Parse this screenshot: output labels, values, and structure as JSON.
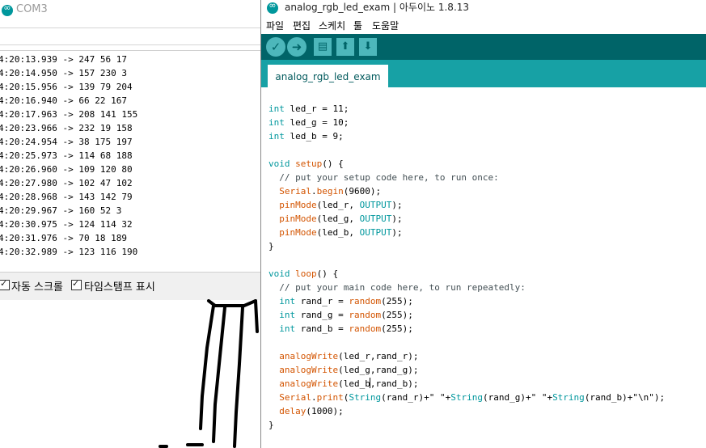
{
  "serial_monitor": {
    "title": "COM3",
    "lines": [
      "4:20:13.939 -> 247 56 17",
      "4:20:14.950 -> 157 230 3",
      "4:20:15.956 -> 139 79 204",
      "4:20:16.940 -> 66 22 167",
      "4:20:17.963 -> 208 141 155",
      "4:20:23.966 -> 232 19 158",
      "4:20:24.954 -> 38 175 197",
      "4:20:25.973 -> 114 68 188",
      "4:20:26.960 -> 109 120 80",
      "4:20:27.980 -> 102 47 102",
      "4:20:28.968 -> 143 142 79",
      "4:20:29.967 -> 160 52 3",
      "4:20:30.975 -> 124 114 32",
      "4:20:31.976 -> 70 18 189",
      "4:20:32.989 -> 123 116 190"
    ],
    "autoscroll_label": "자동 스크롤",
    "autoscroll_checked": true,
    "timestamp_label": "타임스탬프 표시",
    "timestamp_checked": true
  },
  "ide": {
    "title": "analog_rgb_led_exam | 아두이노 1.8.13",
    "menu": [
      "파일",
      "편집",
      "스케치",
      "툴",
      "도움말"
    ],
    "toolbar": {
      "verify_icon": "check-icon",
      "upload_icon": "arrow-right-icon",
      "new_icon": "file-icon",
      "open_icon": "arrow-up-icon",
      "save_icon": "arrow-down-icon"
    },
    "tab": "analog_rgb_led_exam",
    "code_lines": [
      "int led_r = 11;",
      "int led_g = 10;",
      "int led_b = 9;",
      "",
      "void setup() {",
      "  // put your setup code here, to run once:",
      "  Serial.begin(9600);",
      "  pinMode(led_r, OUTPUT);",
      "  pinMode(led_g, OUTPUT);",
      "  pinMode(led_b, OUTPUT);",
      "}",
      "",
      "void loop() {",
      "  // put your main code here, to run repeatedly:",
      "  int rand_r = random(255);",
      "  int rand_g = random(255);",
      "  int rand_b = random(255);",
      "",
      "  analogWrite(led_r,rand_r);",
      "  analogWrite(led_g,rand_g);",
      "  analogWrite(led_b,rand_b);",
      "  Serial.print(String(rand_r)+\" \"+String(rand_g)+\" \"+String(rand_b)+\"\\n\");",
      "  delay(1000);",
      "}"
    ]
  },
  "colors": {
    "toolbar_bg": "#006468",
    "tab_bar_bg": "#17a1a5",
    "button_bg": "#4db7bb",
    "keyword": "#00979d",
    "function": "#d35400",
    "comment": "#434f54"
  }
}
